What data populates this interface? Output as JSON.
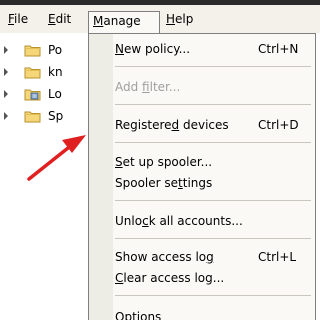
{
  "menubar": {
    "file": {
      "pre": "",
      "u": "F",
      "post": "ile"
    },
    "edit": {
      "pre": "",
      "u": "E",
      "post": "dit"
    },
    "manage": {
      "pre": "",
      "u": "M",
      "post": "anage"
    },
    "help": {
      "pre": "",
      "u": "H",
      "post": "elp"
    }
  },
  "tree": {
    "items": [
      {
        "label": "Po",
        "icon": "folder-icon"
      },
      {
        "label": "kn",
        "icon": "folder-icon"
      },
      {
        "label": "Lo",
        "icon": "log-folder-icon"
      },
      {
        "label": "Sp",
        "icon": "folder-icon"
      }
    ]
  },
  "manage_menu": {
    "new_policy": {
      "pre": "",
      "u": "N",
      "post": "ew policy...",
      "shortcut": "Ctrl+N"
    },
    "add_filter": {
      "pre": "Add ",
      "u": "f",
      "post": "ilter...",
      "shortcut": ""
    },
    "registered_devices": {
      "pre": "Registere",
      "u": "d",
      "post": " devices",
      "shortcut": "Ctrl+D"
    },
    "set_up_spooler": {
      "pre": "",
      "u": "S",
      "post": "et up spooler...",
      "shortcut": ""
    },
    "spooler_settings": {
      "pre": "Spooler se",
      "u": "t",
      "post": "tings",
      "shortcut": ""
    },
    "unlock_accounts": {
      "pre": "Unlo",
      "u": "c",
      "post": "k all accounts...",
      "shortcut": ""
    },
    "show_access_log": {
      "pre": "Show access lo",
      "u": "g",
      "post": "",
      "shortcut": "Ctrl+L"
    },
    "clear_access_log": {
      "pre": "",
      "u": "C",
      "post": "lear access log...",
      "shortcut": ""
    },
    "options": {
      "pre": "",
      "u": "O",
      "post": "ptions",
      "shortcut": ""
    }
  },
  "colors": {
    "annotation_arrow": "#e02020",
    "menu_background": "#faf9f5",
    "menubar_background": "#f3f1ea"
  }
}
